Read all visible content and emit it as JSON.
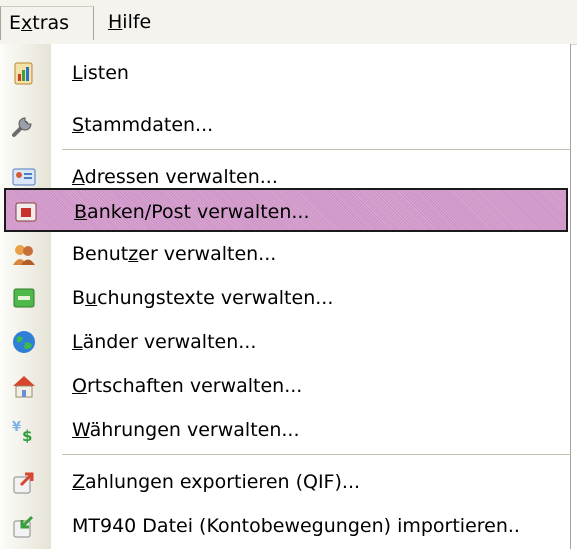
{
  "menubar": {
    "extras": {
      "label_pre": "E",
      "label_ul": "x",
      "label_post": "tras"
    },
    "hilfe": {
      "label_ul": "H",
      "label_post": "ilfe"
    }
  },
  "menu": {
    "items": [
      {
        "icon": "report-chart-icon",
        "ul_pre": "",
        "ul": "L",
        "post": "isten"
      },
      {
        "icon": "wrench-icon",
        "ul_pre": "",
        "ul": "S",
        "post": "tammdaten..."
      },
      {
        "icon": "address-card-icon",
        "ul_pre": "",
        "ul": "A",
        "post": "dressen verwalten..."
      },
      {
        "icon": "bank-post-icon",
        "ul_pre": "",
        "ul": "B",
        "post": "anken/Post verwalten...",
        "selected": true
      },
      {
        "icon": "users-icon",
        "ul_pre": "Benut",
        "ul": "z",
        "post": "er verwalten..."
      },
      {
        "icon": "booking-text-icon",
        "ul_pre": "B",
        "ul": "u",
        "post": "chungstexte verwalten..."
      },
      {
        "icon": "globe-icon",
        "ul_pre": "",
        "ul": "L",
        "post": "änder verwalten..."
      },
      {
        "icon": "house-icon",
        "ul_pre": "",
        "ul": "O",
        "post": "rtschaften verwalten..."
      },
      {
        "icon": "currency-icon",
        "ul_pre": "",
        "ul": "W",
        "post": "ährungen verwalten..."
      },
      {
        "icon": "export-icon",
        "ul_pre": "",
        "ul": "Z",
        "post": "ahlungen exportieren (QIF)..."
      },
      {
        "icon": "import-icon",
        "ul_pre": "MT940 Datei (Kontobewegungen) importieren..",
        "ul": "",
        "post": ""
      }
    ]
  }
}
